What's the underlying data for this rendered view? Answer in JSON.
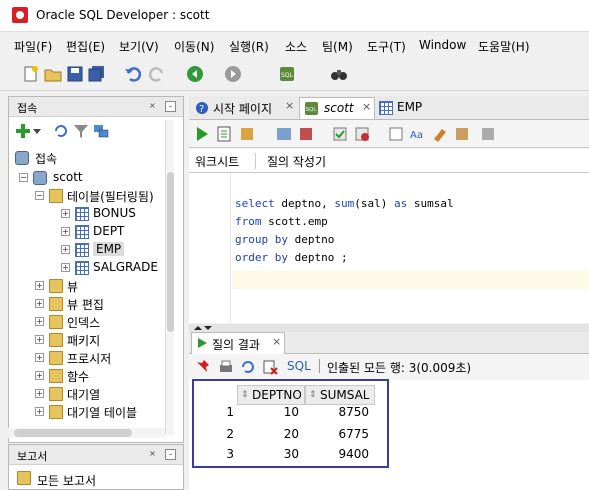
{
  "window": {
    "title": "Oracle SQL Developer : scott"
  },
  "menu": [
    "파일(F)",
    "편집(E)",
    "보기(V)",
    "이동(N)",
    "실행(R)",
    "소스",
    "팀(M)",
    "도구(T)",
    "Window",
    "도움말(H)"
  ],
  "icons": {
    "new": "new-file-icon",
    "open": "open-folder-icon",
    "save": "save-icon",
    "save_all": "save-all-icon",
    "undo": "undo-icon",
    "redo": "redo-icon",
    "back": "back-arrow-icon",
    "forward": "forward-arrow-icon",
    "sql": "sql-icon",
    "binoculars": "binoculars-icon"
  },
  "connections": {
    "header": "접속",
    "root": "접속",
    "connection": "scott",
    "tables_folder": "테이블(필터링됨)",
    "tables": [
      "BONUS",
      "DEPT",
      "EMP",
      "SALGRADE"
    ],
    "selected_table": "EMP",
    "folders": [
      "뷰",
      "뷰 편집",
      "인덱스",
      "패키지",
      "프로시저",
      "함수",
      "대기열",
      "대기열 테이블"
    ]
  },
  "reports": {
    "header": "보고서",
    "item": "모든 보고서"
  },
  "editor_tabs": [
    {
      "label": "시작 페이지"
    },
    {
      "label": "scott"
    },
    {
      "label": "EMP"
    }
  ],
  "sub_tabs": {
    "worksheet": "워크시트",
    "query_builder": "질의 작성기"
  },
  "sql_lines": [
    [
      {
        "t": "select",
        "k": 1
      },
      {
        "t": " deptno, ",
        "k": 0
      },
      {
        "t": "sum",
        "k": 1
      },
      {
        "t": "(sal) ",
        "k": 0
      },
      {
        "t": "as",
        "k": 1
      },
      {
        "t": " sumsal",
        "k": 0
      }
    ],
    [
      {
        "t": "from",
        "k": 1
      },
      {
        "t": " scott.emp",
        "k": 0
      }
    ],
    [
      {
        "t": "group by",
        "k": 1
      },
      {
        "t": " deptno",
        "k": 0
      }
    ],
    [
      {
        "t": "order by",
        "k": 1
      },
      {
        "t": " deptno ;",
        "k": 0
      }
    ]
  ],
  "results": {
    "tab_label": "질의 결과",
    "sql_label": "SQL",
    "fetched_text": "인출된 모든 행: 3(0.009초)",
    "columns": [
      "DEPTNO",
      "SUMSAL"
    ],
    "rows": [
      {
        "num": "1",
        "deptno": "10",
        "sumsal": "8750"
      },
      {
        "num": "2",
        "deptno": "20",
        "sumsal": "6775"
      },
      {
        "num": "3",
        "deptno": "30",
        "sumsal": "9400"
      }
    ]
  },
  "colors": {
    "keyword": "#1f3fb5",
    "highlight_frame": "#3b3ba0",
    "run_green": "#2a9a2a"
  }
}
